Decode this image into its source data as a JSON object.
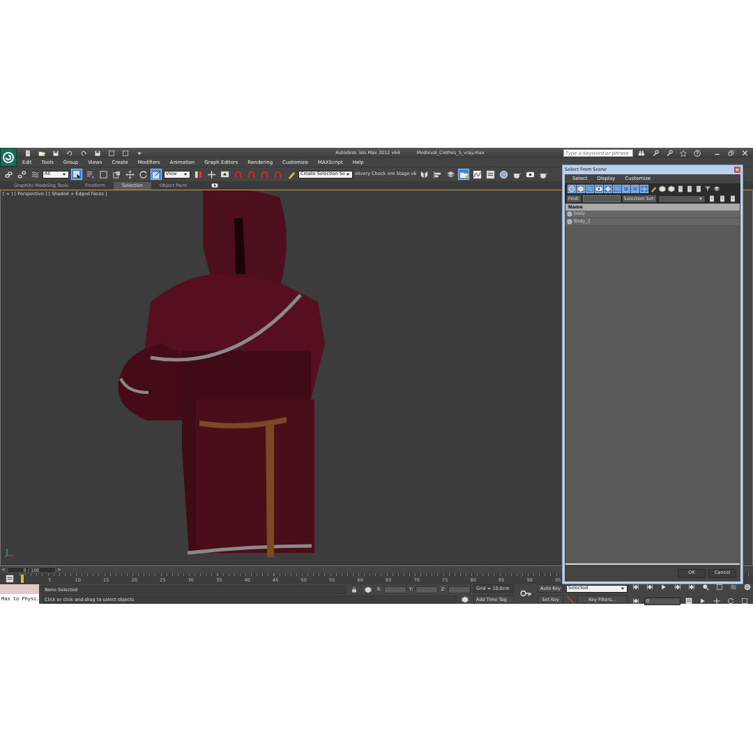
{
  "window": {
    "title": "Autodesk 3ds Max  2012 x64",
    "file": "Medieval_Clothes_5_vray.max",
    "search": {
      "placeholder": "Type a keyword or phrase"
    }
  },
  "menu": [
    "Edit",
    "Tools",
    "Group",
    "Views",
    "Create",
    "Modifiers",
    "Animation",
    "Graph Editors",
    "Rendering",
    "Customize",
    "MAXScript",
    "Help"
  ],
  "toolbar": [
    {
      "kind": "button",
      "active": false
    },
    {
      "kind": "button",
      "active": false
    },
    {
      "kind": "button",
      "active": false
    },
    {
      "kind": "dropdown",
      "value": "All"
    },
    {
      "kind": "button",
      "active": true
    },
    {
      "kind": "button",
      "active": false
    },
    {
      "kind": "button",
      "active": false
    },
    {
      "kind": "button",
      "active": false
    },
    {
      "kind": "button",
      "active": false
    },
    {
      "kind": "button",
      "active": false
    },
    {
      "kind": "button",
      "active": true
    },
    {
      "kind": "dropdown",
      "value": "View"
    },
    {
      "kind": "button",
      "active": false
    },
    {
      "kind": "button",
      "active": false
    },
    {
      "kind": "button",
      "active": false
    },
    {
      "kind": "button",
      "active": false
    },
    {
      "kind": "button",
      "active": false
    },
    {
      "kind": "button",
      "active": false
    },
    {
      "kind": "button",
      "active": false
    },
    {
      "kind": "button",
      "active": false
    },
    {
      "kind": "dropdown",
      "value": "Create Selection Se"
    },
    {
      "kind": "text",
      "text": "elivery Check"
    },
    {
      "kind": "text",
      "text": "ero Stage v6"
    },
    {
      "kind": "button",
      "active": false
    },
    {
      "kind": "button",
      "active": false
    },
    {
      "kind": "button",
      "active": false
    },
    {
      "kind": "button",
      "active": true
    },
    {
      "kind": "button",
      "active": false
    },
    {
      "kind": "button",
      "active": false
    },
    {
      "kind": "button",
      "active": false
    },
    {
      "kind": "button",
      "active": false
    },
    {
      "kind": "button",
      "active": false
    },
    {
      "kind": "button",
      "active": false
    }
  ],
  "ribbon_tabs": [
    {
      "label": "Graphite Modeling Tools",
      "selected": false
    },
    {
      "label": "Freeform",
      "selected": false
    },
    {
      "label": "Selection",
      "selected": true
    },
    {
      "label": "Object Paint",
      "selected": false
    }
  ],
  "viewport": {
    "label": "[ + ] [ Perspective ] [ Shaded + Edged Faces ]"
  },
  "time_slider": {
    "prev": "<",
    "reading": "0 / 100",
    "next": ">"
  },
  "track_ticks": [
    "5",
    "10",
    "15",
    "20",
    "25",
    "30",
    "35",
    "40",
    "45",
    "50",
    "55",
    "60",
    "65",
    "70",
    "75",
    "80",
    "85",
    "90",
    "95"
  ],
  "status": {
    "listener": "Max to Physc.",
    "selection": "None Selected",
    "prompt": "Click or click-and-drag to select objects",
    "x_label": "X:",
    "y_label": "Y:",
    "z_label": "Z:",
    "grid": "Grid = 10,0cm",
    "time_tag": "Add Time Tag"
  },
  "animation": {
    "auto_key": "Auto Key",
    "key_mode": "Selected",
    "set_key": "Set Key",
    "key_filters": "Key Filters...",
    "frame": "0"
  },
  "dialog": {
    "title": "Select From Scene",
    "menu": [
      "Select",
      "Display",
      "Customize"
    ],
    "filters": [
      {
        "selected": true
      },
      {
        "selected": true
      },
      {
        "selected": true
      },
      {
        "selected": true
      },
      {
        "selected": true
      },
      {
        "selected": true
      },
      {
        "selected": true
      },
      {
        "selected": true
      },
      {
        "selected": true
      },
      {
        "selected": false
      },
      {
        "selected": false
      },
      {
        "selected": false
      },
      {
        "selected": false
      },
      {
        "selected": false
      },
      {
        "selected": false
      },
      {
        "selected": false
      },
      {
        "selected": false
      }
    ],
    "find_label": "Find:",
    "selection_set_label": "Selection Set:",
    "column": "Name",
    "objects": [
      {
        "name": "body"
      },
      {
        "name": "Body_2"
      }
    ],
    "buttons": [
      "OK",
      "Cancel"
    ]
  }
}
